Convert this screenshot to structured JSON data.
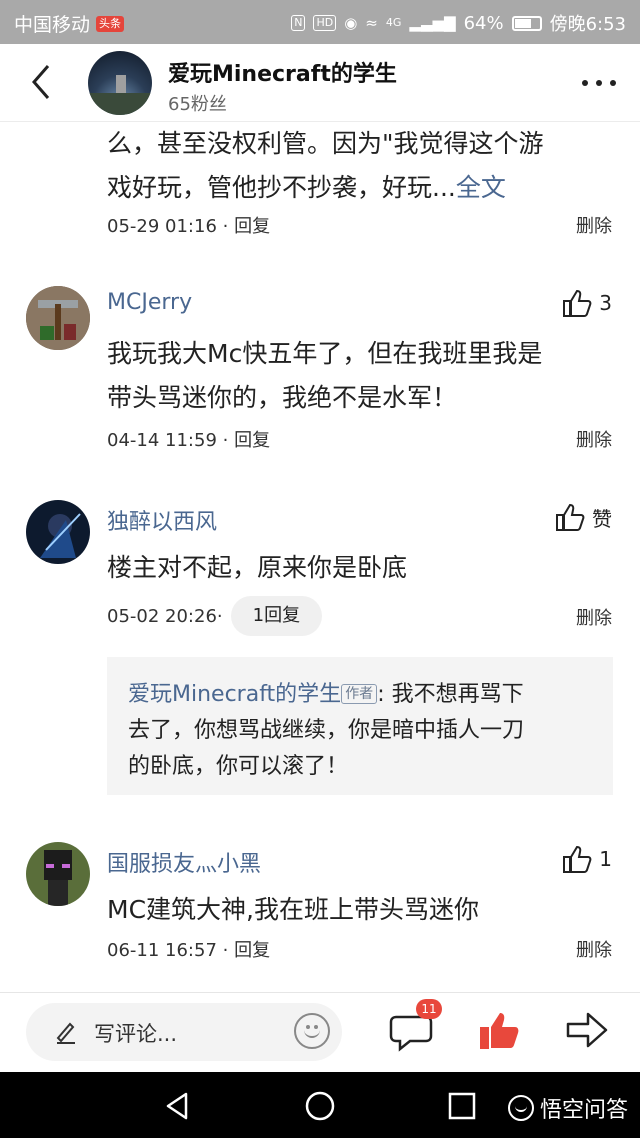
{
  "status_bar": {
    "carrier": "中国移动",
    "carrier_badge": "头条",
    "network": "4G",
    "battery": "64%",
    "battery_level": 0.64,
    "time": "傍晚6:53"
  },
  "header": {
    "title": "爱玩Minecraft的学生",
    "fans": "65粉丝"
  },
  "top_comment": {
    "line1": "么，甚至没权利管。因为\"我觉得这个游",
    "line2": "戏好玩，管他抄不抄袭，好玩...",
    "expand_label": "全文",
    "time": "05-29 01:16",
    "separator": " · ",
    "reply_label": "回复",
    "delete_label": "删除"
  },
  "comments": [
    {
      "user": "MCJerry",
      "likes": "3",
      "line1": "我玩我大Mc快五年了，但在我班里我是",
      "line2": "带头骂迷你的，我绝不是水军！",
      "time": "04-14 11:59",
      "reply_label": "回复",
      "delete_label": "删除"
    },
    {
      "user": "独醉以西风",
      "likes": "赞",
      "line1": "楼主对不起，原来你是卧底",
      "time": "05-02 20:26",
      "reply_count_label": "1回复",
      "delete_label": "删除",
      "sub_reply": {
        "author": "爱玩Minecraft的学生",
        "author_tag": "作者",
        "line1": ": 我不想再骂下",
        "line2": "去了，你想骂战继续，你是暗中插人一刀",
        "line3": "的卧底，你可以滚了！"
      }
    },
    {
      "user": "国服损友灬小黑",
      "likes": "1",
      "line1": "MC建筑大神,我在班上带头骂迷你",
      "time": "06-11 16:57",
      "reply_label": "回复",
      "delete_label": "删除"
    }
  ],
  "bottom_bar": {
    "placeholder": "写评论...",
    "comment_count": "11"
  },
  "watermark": "悟空问答",
  "colors": {
    "link": "#4a6790",
    "like_active": "#e8483c",
    "status_bar_bg": "#a9a9a9"
  }
}
